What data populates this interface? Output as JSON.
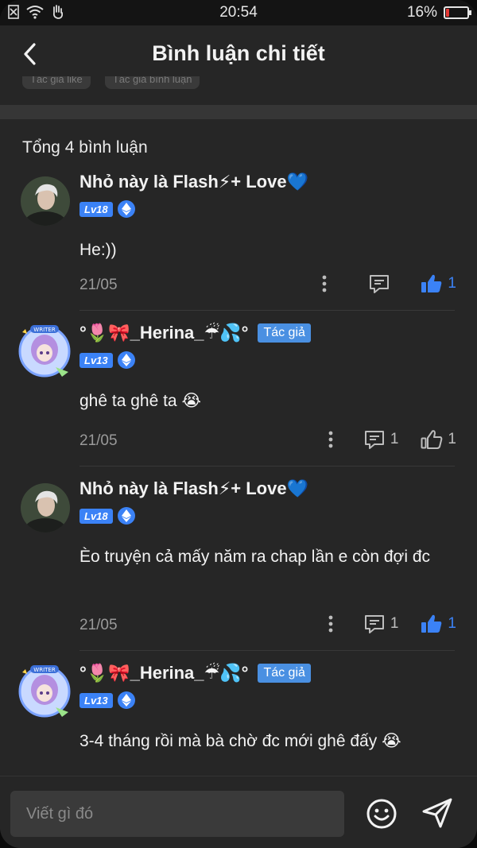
{
  "status": {
    "time": "20:54",
    "battery": "16%",
    "battery_level": 0.16
  },
  "header": {
    "title": "Bình luận chi tiết",
    "filters": [
      "Tác giả like",
      "Tác giả bình luận"
    ]
  },
  "total": "Tổng 4 bình luận",
  "comments": [
    {
      "name": "Nhỏ này là Flash⚡+ Love💙",
      "level": "Lv18",
      "text": "He:))",
      "date": "21/05",
      "reply_count": "",
      "like_count": "1",
      "liked": true,
      "author": false
    },
    {
      "name": "°🌷🎀_Herina_☔💦°",
      "author_badge": "Tác giả",
      "level": "Lv13",
      "text": "ghê ta ghê ta 😭",
      "date": "21/05",
      "reply_count": "1",
      "like_count": "1",
      "liked": false,
      "author": true
    },
    {
      "name": "Nhỏ này là Flash⚡+ Love💙",
      "level": "Lv18",
      "text": "Èo truyện cả mấy năm ra chap lần e còn đợi đc",
      "date": "21/05",
      "reply_count": "1",
      "like_count": "1",
      "liked": true,
      "author": false
    },
    {
      "name": "°🌷🎀_Herina_☔💦°",
      "author_badge": "Tác giả",
      "level": "Lv13",
      "text": "3-4 tháng rồi mà bà chờ đc mới ghê đấy 😭",
      "date": "",
      "reply_count": "",
      "like_count": "",
      "liked": false,
      "author": true
    }
  ],
  "composer": {
    "placeholder": "Viết gì đó"
  },
  "colors": {
    "accent": "#3b82f6",
    "background": "#262626",
    "battery_low": "#e53935"
  }
}
